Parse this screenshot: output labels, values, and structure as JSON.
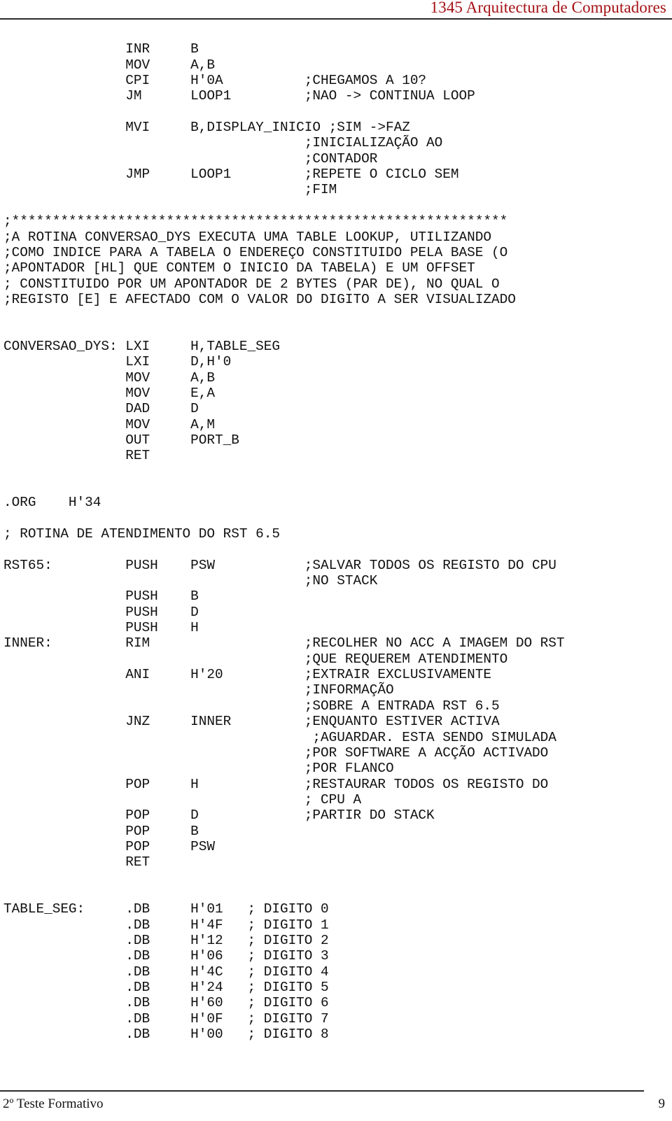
{
  "header": {
    "title": "1345 Arquitectura de Computadores",
    "title_color": "#a41014",
    "rule_color": "#2b2b2b"
  },
  "footer": {
    "left_text": "2º Teste Formativo",
    "page_number": "9",
    "rule_color": "#2b2b2b"
  },
  "document": {
    "language": "pt",
    "content_type": "assembly-listing",
    "text_color": "#111111"
  },
  "code": {
    "columns": {
      "label_col": 0,
      "mnemonic_col": 15,
      "operand_col": 24,
      "comment_col": 38
    },
    "lines": [
      "               INR     B",
      "               MOV     A,B",
      "               CPI     H'0A          ;CHEGAMOS A 10?",
      "               JM      LOOP1         ;NAO -> CONTINUA LOOP",
      "",
      "               MVI     B,DISPLAY_INICIO ;SIM ->FAZ",
      "                                     ;INICIALIZAÇÃO AO",
      "                                     ;CONTADOR",
      "               JMP     LOOP1         ;REPETE O CICLO SEM",
      "                                     ;FIM",
      "",
      ";*************************************************************",
      ";A ROTINA CONVERSAO_DYS EXECUTA UMA TABLE LOOKUP, UTILIZANDO",
      ";COMO INDICE PARA A TABELA O ENDEREÇO CONSTITUIDO PELA BASE (O",
      ";APONTADOR [HL] QUE CONTEM O INICIO DA TABELA) E UM OFFSET",
      "; CONSTITUIDO POR UM APONTADOR DE 2 BYTES (PAR DE), NO QUAL O",
      ";REGISTO [E] E AFECTADO COM O VALOR DO DIGITO A SER VISUALIZADO",
      "",
      "",
      "CONVERSAO_DYS: LXI     H,TABLE_SEG",
      "               LXI     D,H'0",
      "               MOV     A,B",
      "               MOV     E,A",
      "               DAD     D",
      "               MOV     A,M",
      "               OUT     PORT_B",
      "               RET",
      "",
      "",
      ".ORG    H'34",
      "",
      "; ROTINA DE ATENDIMENTO DO RST 6.5",
      "",
      "RST65:         PUSH    PSW           ;SALVAR TODOS OS REGISTO DO CPU",
      "                                     ;NO STACK",
      "               PUSH    B",
      "               PUSH    D",
      "               PUSH    H",
      "INNER:         RIM                   ;RECOLHER NO ACC A IMAGEM DO RST",
      "                                     ;QUE REQUEREM ATENDIMENTO",
      "               ANI     H'20          ;EXTRAIR EXCLUSIVAMENTE",
      "                                     ;INFORMAÇÃO",
      "                                     ;SOBRE A ENTRADA RST 6.5",
      "               JNZ     INNER         ;ENQUANTO ESTIVER ACTIVA",
      "                                      ;AGUARDAR. ESTA SENDO SIMULADA",
      "                                     ;POR SOFTWARE A ACÇÃO ACTIVADO",
      "                                     ;POR FLANCO",
      "               POP     H             ;RESTAURAR TODOS OS REGISTO DO",
      "                                     ; CPU A",
      "               POP     D             ;PARTIR DO STACK",
      "               POP     B",
      "               POP     PSW",
      "               RET",
      "",
      "",
      "TABLE_SEG:     .DB     H'01   ; DIGITO 0",
      "               .DB     H'4F   ; DIGITO 1",
      "               .DB     H'12   ; DIGITO 2",
      "               .DB     H'06   ; DIGITO 3",
      "               .DB     H'4C   ; DIGITO 4",
      "               .DB     H'24   ; DIGITO 5",
      "               .DB     H'60   ; DIGITO 6",
      "               .DB     H'0F   ; DIGITO 7",
      "               .DB     H'00   ; DIGITO 8"
    ]
  }
}
